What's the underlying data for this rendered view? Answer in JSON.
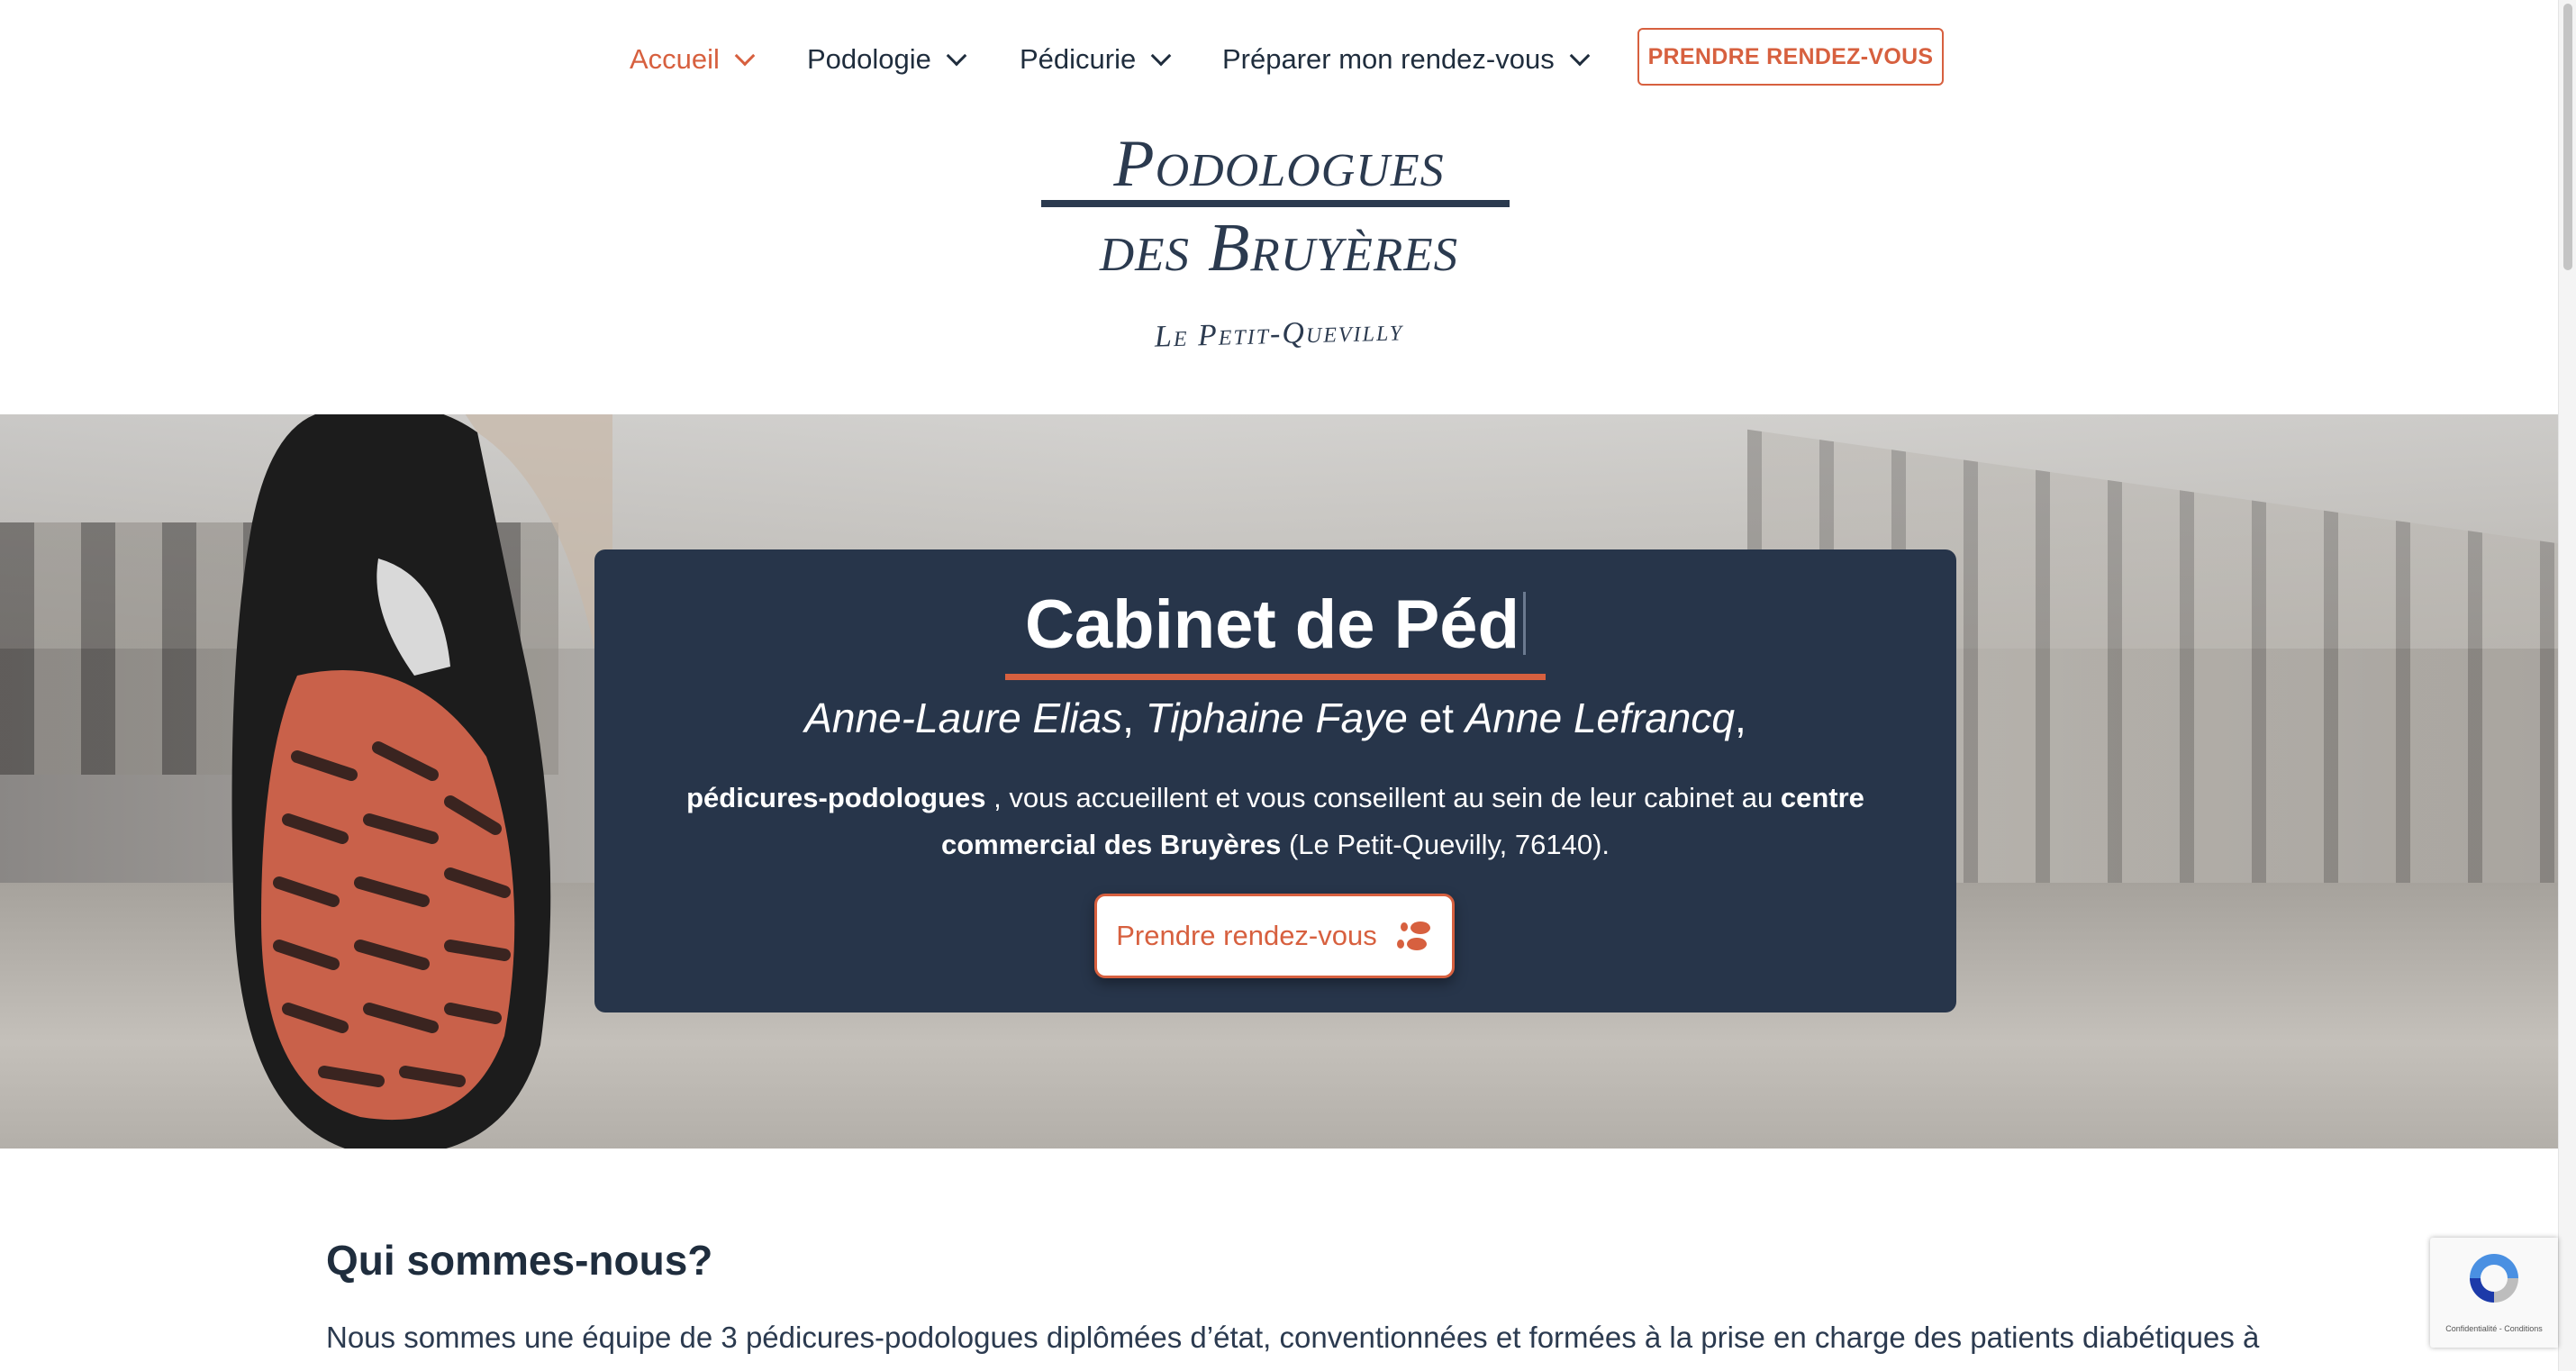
{
  "nav": {
    "items": [
      {
        "label": "Accueil",
        "active": true
      },
      {
        "label": "Podologie",
        "active": false
      },
      {
        "label": "Pédicurie",
        "active": false
      },
      {
        "label": "Préparer mon rendez-vous",
        "active": false
      }
    ],
    "cta_label": "PRENDRE RENDEZ-VOUS"
  },
  "logo": {
    "line1": "Podologues",
    "line2": "des Bruyères",
    "subtitle": "Le Petit-Quevilly"
  },
  "hero": {
    "title": "Cabinet de Péd",
    "names": {
      "name1": "Anne-Laure Elias",
      "sep1": ",",
      "name2": "Tiphaine Faye",
      "and": " et ",
      "name3": "Anne Lefrancq",
      "sep2": ","
    },
    "desc": {
      "strong1": "pédicures-podologues",
      "text1": " , vous accueillent et vous conseillent au sein de leur cabinet au ",
      "strong2": "centre commercial des Bruyères",
      "text2": " (Le Petit-Quevilly, 76140)."
    },
    "button_label": "Prendre rendez-vous",
    "button_icon": "footprints-icon"
  },
  "about": {
    "title": "Qui sommes-nous?",
    "text": "Nous sommes une équipe de 3 pédicures-podologues diplômées d’état, conventionnées et formées à la prise en charge des patients diabétiques à"
  },
  "recaptcha": {
    "text": "Confidentialité - Conditions"
  },
  "colors": {
    "accent": "#d7603f",
    "navy": "#27354a",
    "text": "#1f2d3d"
  }
}
